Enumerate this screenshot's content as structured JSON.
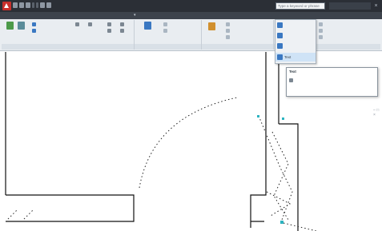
{
  "app": {
    "title": "",
    "search_placeholder": "Type a keyword or phrase",
    "sign_in": "",
    "close_glyph": "×"
  },
  "tabs": [],
  "ribbon": {
    "panels": [],
    "tools": []
  },
  "dropdown": {
    "items": [
      {
        "label": "",
        "icon": "dimension-icon"
      },
      {
        "label": "",
        "icon": "dimension-icon"
      },
      {
        "label": "",
        "icon": "dimension-icon"
      },
      {
        "label": "Text",
        "icon": "text-icon",
        "highlighted": true
      }
    ]
  },
  "tooltip": {
    "title": "Text",
    "description": "",
    "command": "",
    "help": ""
  },
  "viewport": {
    "controls": "– □ ×"
  },
  "colors": {
    "title_bar": "#2b2f36",
    "ribbon_bg": "#e9edf1",
    "highlight": "#cfe3f6",
    "accent_marker": "#2bb3c0"
  }
}
